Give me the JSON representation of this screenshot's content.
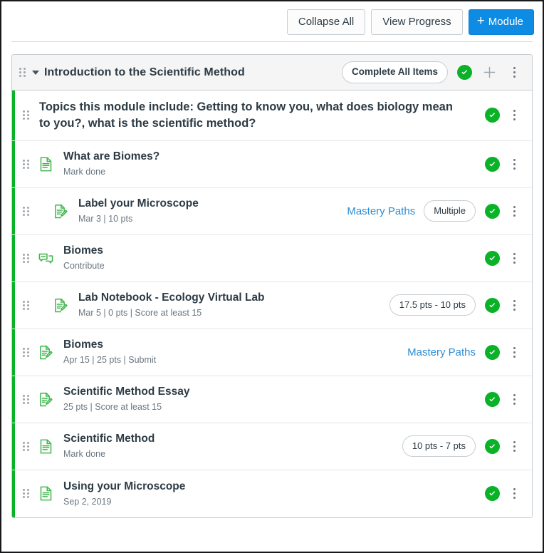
{
  "toolbar": {
    "collapse_all_label": "Collapse All",
    "view_progress_label": "View Progress",
    "add_module_label": "Module",
    "add_module_plus": "+"
  },
  "module": {
    "title": "Introduction to the Scientific Method",
    "complete_all_label": "Complete All Items",
    "drag_handle_name": "drag-handle-icon",
    "collapse_caret_name": "chevron-down-icon"
  },
  "colors": {
    "accent_blue": "#0e8ce4",
    "link_blue": "#2d8cd4",
    "complete_green": "#0ab227",
    "icon_green": "#3db54a",
    "header_bg": "#f5f5f5",
    "border": "#c7cdd1",
    "text": "#2D3B45",
    "muted_text": "#6b7780"
  },
  "items": [
    {
      "type": "text",
      "indent": 0,
      "icon": "none",
      "title": "Topics this module include: Getting to know you, what does biology mean to you?, what is the scientific method?",
      "subtitle": "",
      "mastery_paths": "",
      "pill": "",
      "completed": true
    },
    {
      "type": "page",
      "indent": 0,
      "icon": "document-icon",
      "title": "What are Biomes?",
      "subtitle": "Mark done",
      "mastery_paths": "",
      "pill": "",
      "completed": true
    },
    {
      "type": "assignment",
      "indent": 1,
      "icon": "assignment-icon",
      "title": "Label your Microscope",
      "subtitle": "Mar 3  |  10 pts",
      "mastery_paths": "Mastery Paths",
      "pill": "Multiple",
      "completed": true
    },
    {
      "type": "discussion",
      "indent": 0,
      "icon": "discussion-icon",
      "title": "Biomes",
      "subtitle": "Contribute",
      "mastery_paths": "",
      "pill": "",
      "completed": true
    },
    {
      "type": "assignment",
      "indent": 1,
      "icon": "assignment-icon",
      "title": "Lab Notebook - Ecology Virtual Lab",
      "subtitle": "Mar 5  |  0 pts  |  Score at least 15",
      "mastery_paths": "",
      "pill": "17.5 pts - 10 pts",
      "completed": true
    },
    {
      "type": "assignment",
      "indent": 0,
      "icon": "assignment-icon",
      "title": "Biomes",
      "subtitle": "Apr 15  |  25 pts  |  Submit",
      "mastery_paths": "Mastery Paths",
      "pill": "",
      "completed": true
    },
    {
      "type": "assignment",
      "indent": 0,
      "icon": "assignment-icon",
      "title": "Scientific Method Essay",
      "subtitle": "25 pts  |  Score at least 15",
      "mastery_paths": "",
      "pill": "",
      "completed": true
    },
    {
      "type": "page",
      "indent": 0,
      "icon": "document-icon",
      "title": "Scientific Method",
      "subtitle": "Mark done",
      "mastery_paths": "",
      "pill": "10 pts - 7 pts",
      "completed": true
    },
    {
      "type": "page",
      "indent": 0,
      "icon": "document-icon",
      "title": "Using your Microscope",
      "subtitle": "Sep 2, 2019",
      "mastery_paths": "",
      "pill": "",
      "completed": true
    }
  ]
}
